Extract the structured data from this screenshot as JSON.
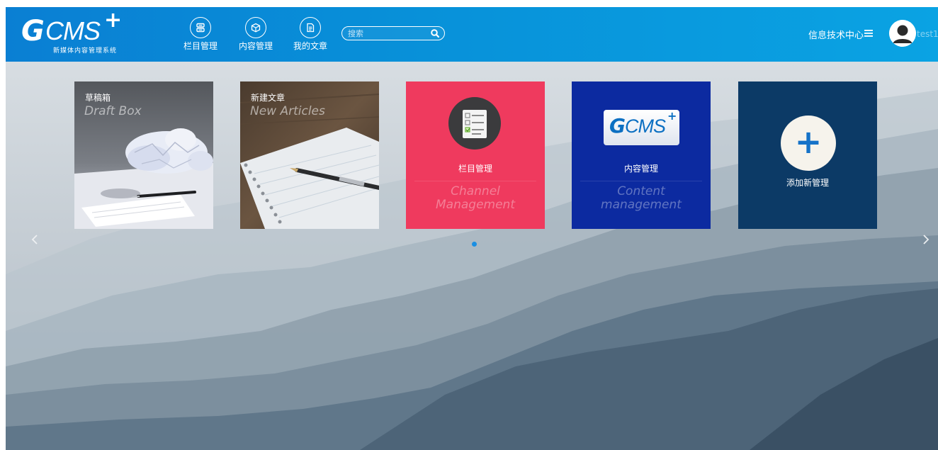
{
  "header": {
    "logo": {
      "mark": "G",
      "text": "CMS",
      "plus": "+",
      "subtitle": "新媒体内容管理系统"
    },
    "nav": [
      {
        "label": "栏目管理",
        "icon": "channel-icon"
      },
      {
        "label": "内容管理",
        "icon": "box-icon"
      },
      {
        "label": "我的文章",
        "icon": "document-icon"
      }
    ],
    "search": {
      "placeholder": "搜索",
      "value": ""
    },
    "org": "信息技术中心",
    "username": "test1"
  },
  "tiles": [
    {
      "title": "草稿箱",
      "subtitle": "Draft Box"
    },
    {
      "title": "新建文章",
      "subtitle": "New Articles"
    },
    {
      "label": "栏目管理",
      "en_line1": "Channel",
      "en_line2": "Management",
      "color": "#ef3a5e"
    },
    {
      "label": "内容管理",
      "en_line1": "Content",
      "en_line2": "management",
      "badge_text": "CMS",
      "badge_mark": "G",
      "badge_plus": "+",
      "color": "#0c2aa0"
    },
    {
      "label": "添加新管理",
      "plus": "+",
      "color": "#0c3a66"
    }
  ],
  "carousel": {
    "pages": 1,
    "active": 1
  },
  "colors": {
    "header_start": "#0a7fd3",
    "header_end": "#0aa3e3",
    "accent_dot": "#1a8fe3",
    "add_plus": "#1572c8"
  }
}
